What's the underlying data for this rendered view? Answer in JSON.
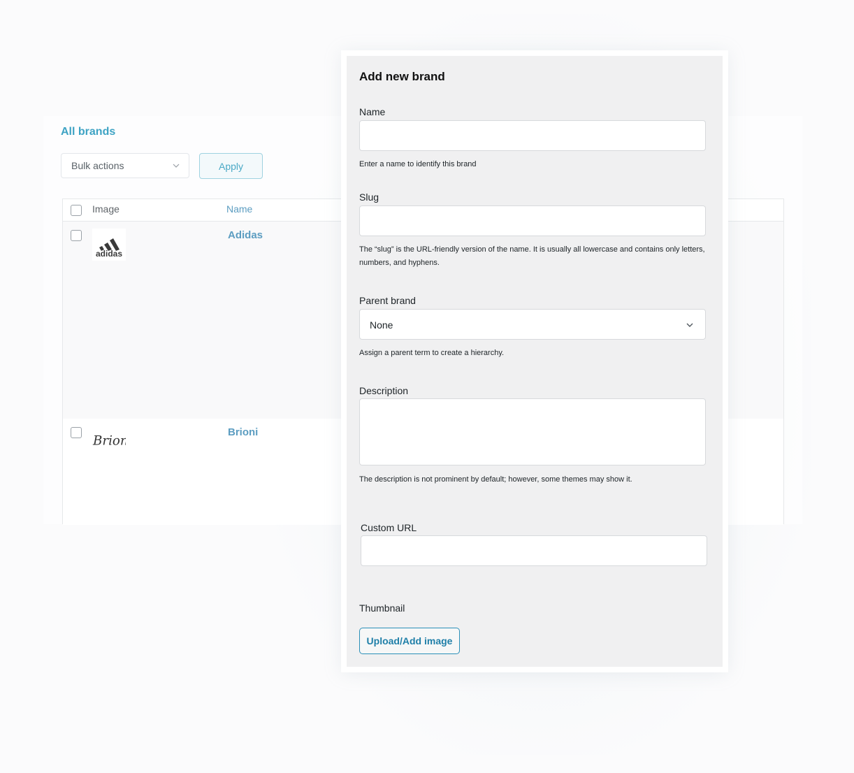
{
  "list": {
    "title": "All brands",
    "bulk_actions_label": "Bulk actions",
    "apply_label": "Apply",
    "columns": {
      "image": "Image",
      "name": "Name"
    },
    "rows": [
      {
        "name": "Adidas",
        "logo_text": "adidas"
      },
      {
        "name": "Brioni",
        "logo_text": "Brioni"
      }
    ]
  },
  "modal": {
    "title": "Add new brand",
    "name_label": "Name",
    "name_value": "",
    "name_help": "Enter a name to identify this brand",
    "slug_label": "Slug",
    "slug_value": "",
    "slug_help_line1": "The “slug” is the URL-friendly version of the name. It is usually all lowercase and contains only letters,",
    "slug_help_line2": "numbers, and hyphens.",
    "parent_label": "Parent brand",
    "parent_value": "None",
    "parent_help": "Assign a parent term to create a hierarchy.",
    "description_label": "Description",
    "description_value": "",
    "description_help": "The description is not prominent by default; however, some themes may show it.",
    "custom_url_label": "Custom URL",
    "custom_url_value": "",
    "thumbnail_label": "Thumbnail",
    "upload_label": "Upload/Add image"
  },
  "colors": {
    "accent": "#3ea3c4",
    "link": "#5c9dc1",
    "button_border": "#2a8fb8",
    "modal_bg": "#f0f0f1"
  },
  "icons": [
    "chevron-down-icon",
    "checkbox-icon",
    "adidas-logo",
    "brioni-logo"
  ]
}
